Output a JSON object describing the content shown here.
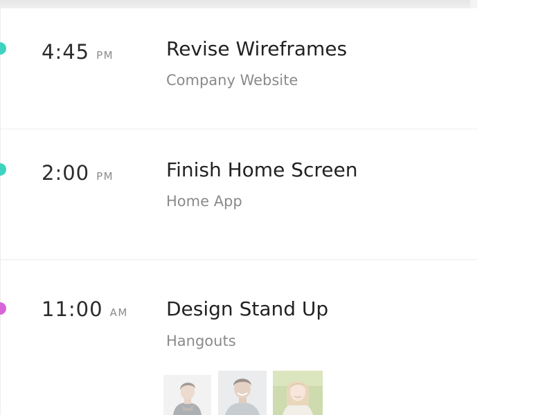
{
  "colors": {
    "dot_teal": "#3ed3bf",
    "dot_magenta": "#d665d8"
  },
  "events": [
    {
      "time": "4:45",
      "meridiem": "PM",
      "title": "Revise Wireframes",
      "subtitle": "Company Website",
      "dot_color": "teal"
    },
    {
      "time": "2:00",
      "meridiem": "PM",
      "title": "Finish Home Screen",
      "subtitle": "Home App",
      "dot_color": "teal"
    },
    {
      "time": "11:00",
      "meridiem": "AM",
      "title": "Design Stand Up",
      "subtitle": "Hangouts",
      "dot_color": "magenta",
      "attendees": [
        "person-avatar",
        "person-avatar",
        "person-avatar"
      ]
    }
  ]
}
